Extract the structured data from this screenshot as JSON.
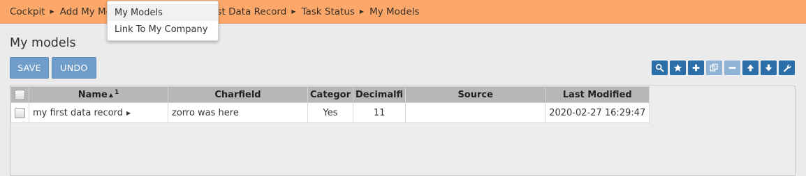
{
  "breadcrumb": [
    {
      "label": "Cockpit"
    },
    {
      "label": "Add My Model"
    },
    {
      "label": "My Model My First Data Record"
    },
    {
      "label": "Task Status"
    },
    {
      "label": "My Models"
    }
  ],
  "dropdown": {
    "items": [
      {
        "label": "My Models"
      },
      {
        "label": "Link To My Company"
      }
    ]
  },
  "page": {
    "title": "My models"
  },
  "actions": {
    "save_label": "SAVE",
    "undo_label": "UNDO"
  },
  "toolbar": {
    "icons": [
      "search-icon",
      "star-icon",
      "plus-icon",
      "copy-icon",
      "minus-icon",
      "arrow-up-icon",
      "arrow-down-icon",
      "wrench-icon"
    ],
    "accent": "#2c6ea7"
  },
  "table": {
    "columns": [
      "Name",
      "Charfield",
      "Categor",
      "Decimalfi",
      "Source",
      "Last Modified"
    ],
    "sort_order": "1",
    "rows": [
      {
        "name": "my first data record",
        "charfield": "zorro was here",
        "category": "Yes",
        "decimal": "11",
        "source": "",
        "last_modified": "2020-02-27 16:29:47"
      }
    ]
  },
  "colors": {
    "header_bar": "#fba86a",
    "button": "#6f9ecb",
    "table_header": "#b7b7b7"
  }
}
